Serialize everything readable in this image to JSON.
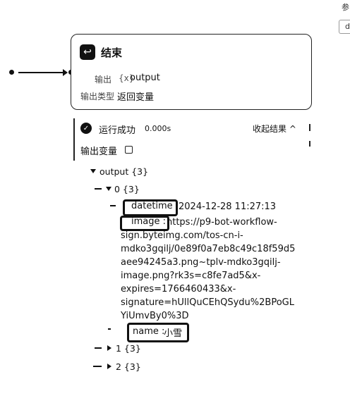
{
  "corner": {
    "top_char": "参",
    "box_char": "d"
  },
  "end_node": {
    "title": "结束",
    "output_label": "输出",
    "output_value": "output",
    "var_label": "输出类型",
    "var_value": "返回变量"
  },
  "run": {
    "status": "运行成功",
    "time": "0.000s",
    "collapse": "收起结果 ^",
    "output_vars_label": "输出变量"
  },
  "tree": {
    "root": "output {3}",
    "item0": "0 {3}",
    "datetime_key": "datetime",
    "datetime_value": "2024-12-28 11:27:13",
    "image_key": "image :",
    "image_value_lines": [
      "https://p9-bot-workflow-",
      "sign.byteimg.com/tos-cn-i-",
      "mdko3gqilj/0e89f0a7eb8c49c18f59d5",
      "aee94245a3.png~tplv-mdko3gqilj-",
      "image.png?rk3s=c8fe7ad5&x-",
      "expires=1766460433&x-",
      "signature=hUllQuCEhQSydu%2BPoGL",
      "YiUmvBy0%3D"
    ],
    "name_key": "name :",
    "name_value": "小雪",
    "item1": "1 {3}",
    "item2": "2 {3}"
  }
}
